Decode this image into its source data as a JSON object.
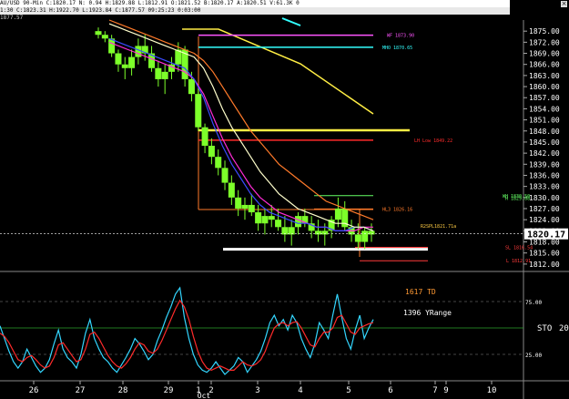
{
  "header": {
    "line1": "AU/USD 90-Min  C:1820.17  N:  0.94  H:1829.88  L:1812.91  O:1821.52  B:1820.17  A:1820.51  V:61.3K  0",
    "line2": "1:30  C:1823.31  H:1922.70  L:1923.84  C:1877.57  09:25:23  0:03:00",
    "line3": "1877.57"
  },
  "chart_data": [
    {
      "type": "line",
      "title": "",
      "x_ticks": [
        "26",
        "27",
        "28",
        "29",
        "1",
        "2",
        "3",
        "4",
        "5",
        "6",
        "7",
        "9",
        "10"
      ],
      "x_sublabel": "Oct",
      "ylim": [
        1810,
        1878
      ],
      "y_ticks": [
        1875.0,
        1872.0,
        1869.0,
        1866.0,
        1863.0,
        1860.0,
        1857.0,
        1854.0,
        1851.0,
        1848.0,
        1845.0,
        1842.0,
        1839.0,
        1836.0,
        1833.0,
        1830.0,
        1827.0,
        1824.0,
        1821.0,
        1818.0,
        1815.0,
        1812.0
      ],
      "current_price": "1820.17",
      "ohlc_approx": [
        [
          1875,
          1876,
          1873,
          1874
        ],
        [
          1874,
          1875,
          1872,
          1873
        ],
        [
          1873,
          1874,
          1868,
          1869
        ],
        [
          1869,
          1870,
          1864,
          1866
        ],
        [
          1866,
          1868,
          1862,
          1865
        ],
        [
          1865,
          1870,
          1863,
          1868
        ],
        [
          1868,
          1873,
          1866,
          1871
        ],
        [
          1871,
          1874,
          1867,
          1869
        ],
        [
          1869,
          1871,
          1864,
          1865
        ],
        [
          1865,
          1867,
          1860,
          1862
        ],
        [
          1862,
          1866,
          1858,
          1864
        ],
        [
          1864,
          1868,
          1862,
          1866
        ],
        [
          1866,
          1872,
          1864,
          1870
        ],
        [
          1870,
          1871,
          1860,
          1862
        ],
        [
          1862,
          1864,
          1856,
          1858
        ],
        [
          1858,
          1860,
          1848,
          1849
        ],
        [
          1849,
          1850,
          1842,
          1844
        ],
        [
          1844,
          1846,
          1839,
          1841
        ],
        [
          1841,
          1843,
          1836,
          1838
        ],
        [
          1838,
          1840,
          1832,
          1834
        ],
        [
          1834,
          1836,
          1828,
          1830
        ],
        [
          1830,
          1832,
          1825,
          1827
        ],
        [
          1827,
          1830,
          1824,
          1828
        ],
        [
          1828,
          1831,
          1825,
          1826
        ],
        [
          1826,
          1828,
          1821,
          1823
        ],
        [
          1823,
          1827,
          1820,
          1825
        ],
        [
          1825,
          1828,
          1822,
          1824
        ],
        [
          1824,
          1827,
          1821,
          1822
        ],
        [
          1822,
          1825,
          1818,
          1820
        ],
        [
          1820,
          1824,
          1817,
          1822
        ],
        [
          1822,
          1826,
          1820,
          1825
        ],
        [
          1825,
          1827,
          1822,
          1823
        ],
        [
          1823,
          1825,
          1819,
          1821
        ],
        [
          1821,
          1824,
          1818,
          1820
        ],
        [
          1820,
          1823,
          1817,
          1821
        ],
        [
          1821,
          1825,
          1819,
          1824
        ],
        [
          1824,
          1830,
          1822,
          1827
        ],
        [
          1827,
          1829,
          1821,
          1822
        ],
        [
          1822,
          1824,
          1818,
          1820
        ],
        [
          1820,
          1823,
          1816,
          1818
        ],
        [
          1818,
          1822,
          1816,
          1821
        ],
        [
          1821,
          1823,
          1818,
          1820
        ]
      ],
      "series": [
        {
          "values": [
            1872,
            1871,
            1870,
            1869,
            1868,
            1867,
            1866,
            1865,
            1864,
            1862,
            1858,
            1852,
            1846,
            1841,
            1837,
            1833,
            1830,
            1828,
            1826,
            1825,
            1824,
            1823,
            1822,
            1822,
            1821,
            1821,
            1821,
            1822,
            1822
          ],
          "color": "#ff2bd6"
        },
        {
          "values": [
            1873,
            1872,
            1871,
            1870,
            1869,
            1868,
            1867,
            1866,
            1865,
            1862,
            1857,
            1850,
            1844,
            1839,
            1835,
            1831,
            1828,
            1826,
            1825,
            1824,
            1823,
            1823,
            1822,
            1822,
            1821,
            1821,
            1822,
            1822,
            1821
          ],
          "color": "#3a4bff"
        },
        {
          "values": [
            1877,
            1876,
            1875,
            1874,
            1873,
            1872,
            1871,
            1870,
            1869,
            1868,
            1865,
            1860,
            1854,
            1849,
            1845,
            1841,
            1837,
            1834,
            1831,
            1829,
            1827,
            1826,
            1825,
            1824,
            1823,
            1823,
            1822,
            1822,
            1821
          ],
          "color": "#ffffcc"
        },
        {
          "values": [
            1878,
            1877,
            1876,
            1875,
            1874,
            1873,
            1872,
            1871,
            1870,
            1869,
            1867,
            1864,
            1860,
            1856,
            1852,
            1848,
            1845,
            1842,
            1839,
            1837,
            1835,
            1833,
            1831,
            1829,
            1828,
            1827,
            1826,
            1825,
            1824
          ],
          "color": "#ff7a2a"
        }
      ],
      "levels": [
        {
          "label": "WF 1873.90",
          "value": 1873.9,
          "color": "#ff55ff"
        },
        {
          "label": "MHO 1870.65",
          "value": 1870.65,
          "color": "#33ffff"
        },
        {
          "label": "LH Low 1849.22",
          "value": 1845.5,
          "color": "#ff2b2b"
        },
        {
          "label": "WH 1830.50",
          "value": 1830.5,
          "color": "#66ff66"
        },
        {
          "label": "H 1829.88",
          "value": 1829.88,
          "color": "#66ff66"
        },
        {
          "label": "HL3 1826.16",
          "value": 1826.9,
          "color": "#ff7a2a"
        },
        {
          "label": "R2SPL1821.71a",
          "value": 1822.3,
          "color": "#ffcc44"
        },
        {
          "label": "SL 1816.54",
          "value": 1816.54,
          "color": "#ff3b3b"
        },
        {
          "label": "L 1812.91",
          "value": 1812.91,
          "color": "#ff3b3b"
        }
      ],
      "annotation_lines": [
        {
          "name": "magenta-hline",
          "value": 1873.9,
          "color": "#ff55ff"
        },
        {
          "name": "cyan-hline",
          "value": 1870.65,
          "color": "#33ffff"
        },
        {
          "name": "yellow-hline",
          "value": 1848.2,
          "color": "#ffee44"
        },
        {
          "name": "red-hline",
          "value": 1845.5,
          "color": "#ff2b2b"
        },
        {
          "name": "white-support-line",
          "value": 1816.0,
          "color": "#ffffff"
        }
      ]
    },
    {
      "type": "line",
      "title": "",
      "labels": [
        "1617 TD",
        "1396 YRange"
      ],
      "indicator_label": "STO",
      "indicator_value": "20",
      "ylim": [
        0,
        100
      ],
      "y_ticks": [
        "75.00",
        "25.00"
      ],
      "series": [
        {
          "name": "fast",
          "color": "#33d6ff",
          "values": [
            52,
            40,
            28,
            18,
            12,
            18,
            30,
            22,
            14,
            8,
            12,
            20,
            35,
            48,
            30,
            22,
            18,
            12,
            25,
            45,
            58,
            40,
            30,
            22,
            18,
            12,
            8,
            15,
            22,
            30,
            40,
            35,
            28,
            20,
            25,
            38,
            48,
            60,
            70,
            82,
            88,
            60,
            40,
            25,
            15,
            10,
            8,
            12,
            18,
            12,
            6,
            10,
            14,
            22,
            18,
            8,
            14,
            20,
            28,
            40,
            55,
            62,
            52,
            58,
            48,
            62,
            55,
            40,
            30,
            22,
            35,
            55,
            48,
            40,
            62,
            82,
            60,
            40,
            30,
            48,
            62,
            40,
            50,
            58
          ]
        },
        {
          "name": "slow",
          "color": "#ff2b2b",
          "values": [
            45,
            42,
            36,
            28,
            20,
            18,
            22,
            24,
            20,
            15,
            12,
            14,
            22,
            34,
            36,
            30,
            24,
            18,
            20,
            30,
            44,
            46,
            40,
            32,
            24,
            18,
            14,
            12,
            16,
            22,
            30,
            36,
            34,
            28,
            26,
            30,
            38,
            48,
            58,
            68,
            76,
            70,
            58,
            42,
            28,
            18,
            12,
            10,
            12,
            14,
            12,
            10,
            10,
            14,
            18,
            15,
            14,
            16,
            20,
            28,
            40,
            50,
            54,
            55,
            52,
            55,
            56,
            50,
            42,
            34,
            32,
            40,
            46,
            46,
            50,
            60,
            62,
            54,
            46,
            44,
            50,
            52,
            54,
            55
          ]
        }
      ]
    }
  ]
}
